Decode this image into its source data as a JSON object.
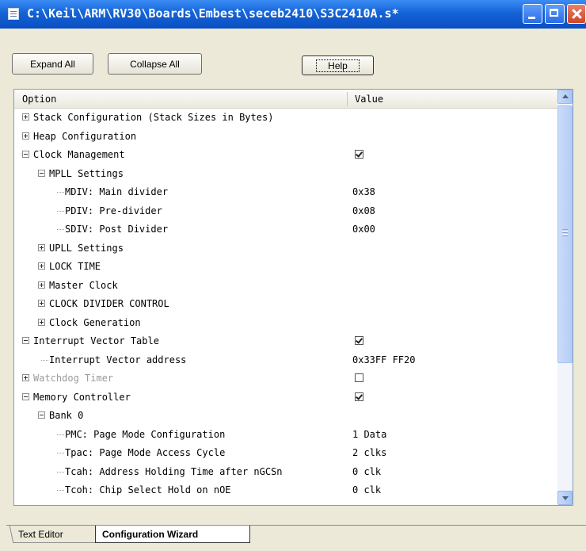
{
  "window": {
    "title": "C:\\Keil\\ARM\\RV30\\Boards\\Embest\\seceb2410\\S3C2410A.s*"
  },
  "toolbar": {
    "expand_all": "Expand All",
    "collapse_all": "Collapse All",
    "help": "Help"
  },
  "columns": {
    "option": "Option",
    "value": "Value"
  },
  "rows": [
    {
      "label": "Stack Configuration (Stack Sizes in Bytes)",
      "level": 0,
      "expander": "plus",
      "value": "",
      "check": null,
      "disabled": false
    },
    {
      "label": "Heap Configuration",
      "level": 0,
      "expander": "plus",
      "value": "",
      "check": null,
      "disabled": false
    },
    {
      "label": "Clock Management",
      "level": 0,
      "expander": "minus",
      "value": "",
      "check": true,
      "disabled": false
    },
    {
      "label": "MPLL Settings",
      "level": 1,
      "expander": "minus",
      "value": "",
      "check": null,
      "disabled": false
    },
    {
      "label": "MDIV: Main divider",
      "level": 2,
      "expander": "",
      "value": "0x38",
      "check": null,
      "disabled": false
    },
    {
      "label": "PDIV: Pre-divider",
      "level": 2,
      "expander": "",
      "value": "0x08",
      "check": null,
      "disabled": false
    },
    {
      "label": "SDIV: Post Divider",
      "level": 2,
      "expander": "",
      "value": "0x00",
      "check": null,
      "disabled": false
    },
    {
      "label": "UPLL Settings",
      "level": 1,
      "expander": "plus",
      "value": "",
      "check": null,
      "disabled": false
    },
    {
      "label": "LOCK TIME",
      "level": 1,
      "expander": "plus",
      "value": "",
      "check": null,
      "disabled": false
    },
    {
      "label": "Master Clock",
      "level": 1,
      "expander": "plus",
      "value": "",
      "check": null,
      "disabled": false
    },
    {
      "label": "CLOCK DIVIDER CONTROL",
      "level": 1,
      "expander": "plus",
      "value": "",
      "check": null,
      "disabled": false
    },
    {
      "label": "Clock Generation",
      "level": 1,
      "expander": "plus",
      "value": "",
      "check": null,
      "disabled": false
    },
    {
      "label": "Interrupt Vector Table",
      "level": 0,
      "expander": "minus",
      "value": "",
      "check": true,
      "disabled": false
    },
    {
      "label": "Interrupt Vector address",
      "level": 1,
      "expander": "",
      "value": "0x33FF FF20",
      "check": null,
      "disabled": false
    },
    {
      "label": "Watchdog Timer",
      "level": 0,
      "expander": "plus",
      "value": "",
      "check": false,
      "disabled": true
    },
    {
      "label": "Memory Controller",
      "level": 0,
      "expander": "minus",
      "value": "",
      "check": true,
      "disabled": false
    },
    {
      "label": "Bank 0",
      "level": 1,
      "expander": "minus",
      "value": "",
      "check": null,
      "disabled": false
    },
    {
      "label": "PMC: Page Mode Configuration",
      "level": 2,
      "expander": "",
      "value": "1 Data",
      "check": null,
      "disabled": false
    },
    {
      "label": "Tpac: Page Mode Access Cycle",
      "level": 2,
      "expander": "",
      "value": "2 clks",
      "check": null,
      "disabled": false
    },
    {
      "label": "Tcah: Address Holding Time after nGCSn",
      "level": 2,
      "expander": "",
      "value": "0 clk",
      "check": null,
      "disabled": false
    },
    {
      "label": "Tcoh: Chip Select Hold on nOE",
      "level": 2,
      "expander": "",
      "value": "0 clk",
      "check": null,
      "disabled": false
    }
  ],
  "tabs": {
    "text_editor": "Text Editor",
    "config_wizard": "Configuration Wizard"
  },
  "icons": {
    "app": "document-icon",
    "minimize": "minimize-icon",
    "maximize": "maximize-icon",
    "close": "close-icon"
  }
}
